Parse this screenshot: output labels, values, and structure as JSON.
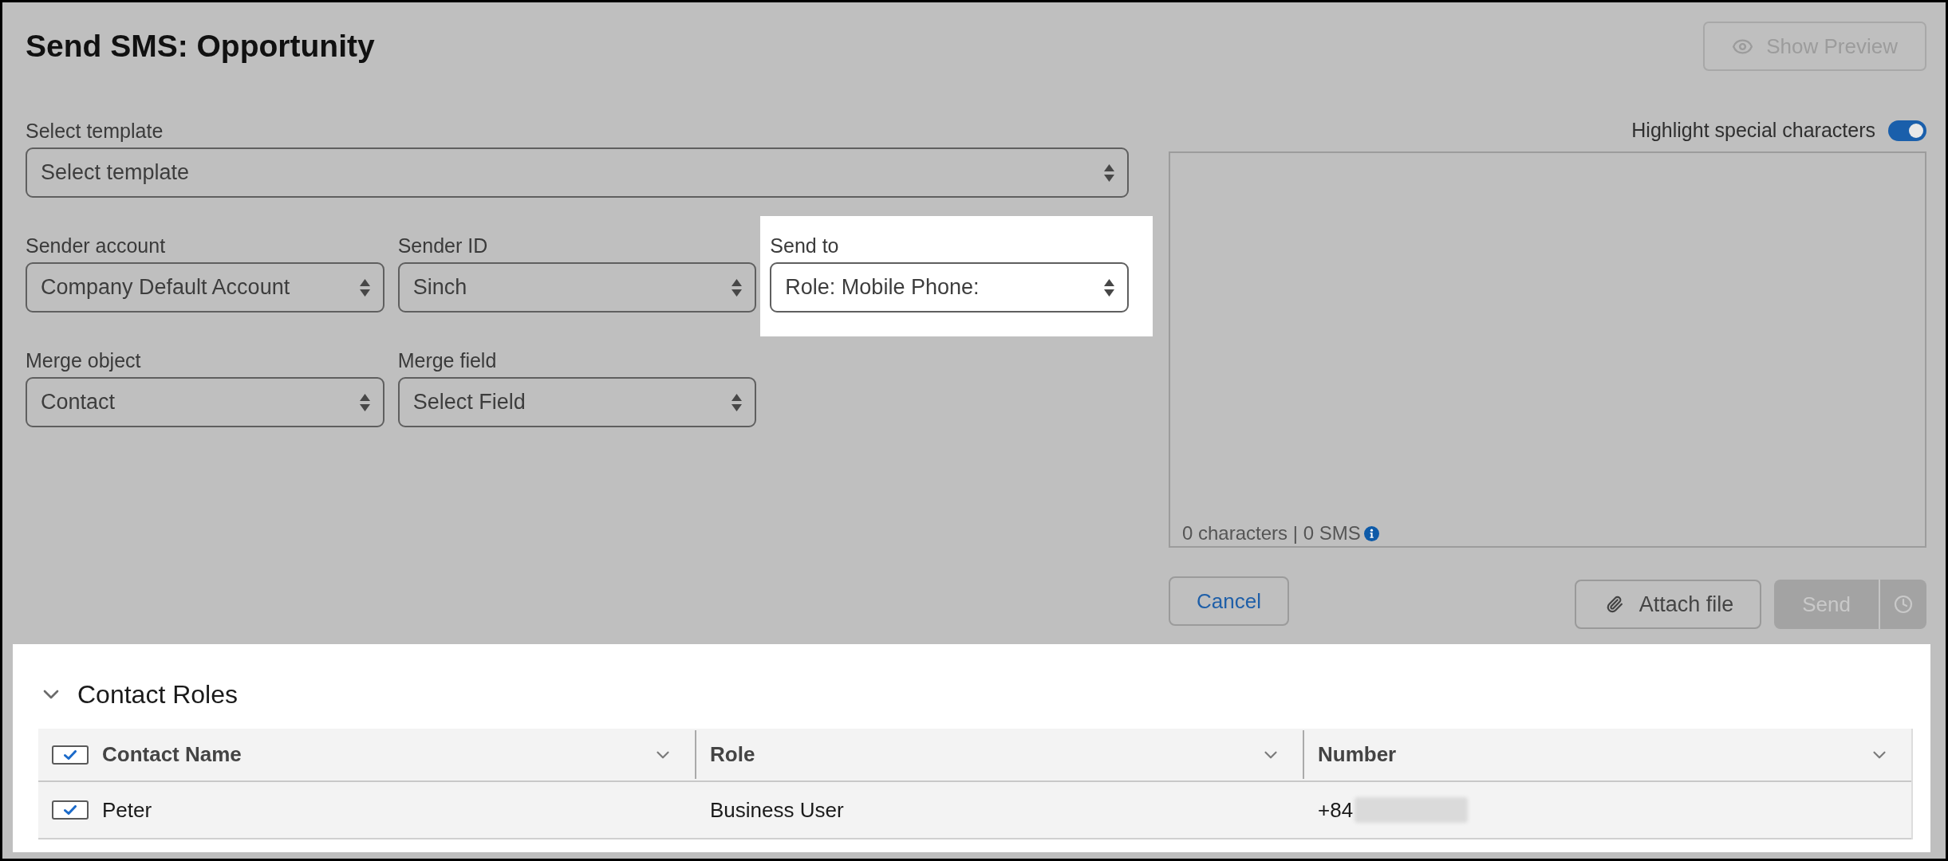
{
  "header": {
    "title": "Send SMS: Opportunity",
    "preview_button": {
      "label": "Show Preview",
      "disabled": true
    }
  },
  "form": {
    "rows": [
      {
        "fields": [
          {
            "label": "Select template",
            "value": "Select template",
            "highlighted": false
          }
        ]
      },
      {
        "fields": [
          {
            "label": "Sender account",
            "value": "Company Default Account",
            "highlighted": false
          },
          {
            "label": "Sender ID",
            "value": "Sinch",
            "highlighted": false
          },
          {
            "label": "Send to",
            "value": "Role: Mobile Phone:",
            "highlighted": true
          }
        ]
      },
      {
        "fields": [
          {
            "label": "Merge object",
            "value": "Contact",
            "highlighted": false
          },
          {
            "label": "Merge field",
            "value": "Select Field",
            "highlighted": false
          }
        ]
      }
    ]
  },
  "message": {
    "highlight_toggle": {
      "label": "Highlight special characters",
      "on": true
    },
    "counter": "0 characters | 0 SMS"
  },
  "actions": {
    "cancel": {
      "label": "Cancel"
    },
    "attach": {
      "label": "Attach file"
    },
    "send": {
      "label": "Send",
      "disabled": true
    },
    "schedule": {
      "disabled": true
    }
  },
  "contact_roles": {
    "title": "Contact Roles",
    "expanded": true,
    "highlighted": true,
    "table": {
      "header_checkbox": {
        "checked": true
      },
      "columns": [
        {
          "label": "Contact Name"
        },
        {
          "label": "Role"
        },
        {
          "label": "Number"
        }
      ],
      "rows": [
        {
          "checked": true,
          "contact_name": "Peter",
          "role": "Business User",
          "number": "+84",
          "redacted": true
        }
      ]
    }
  }
}
